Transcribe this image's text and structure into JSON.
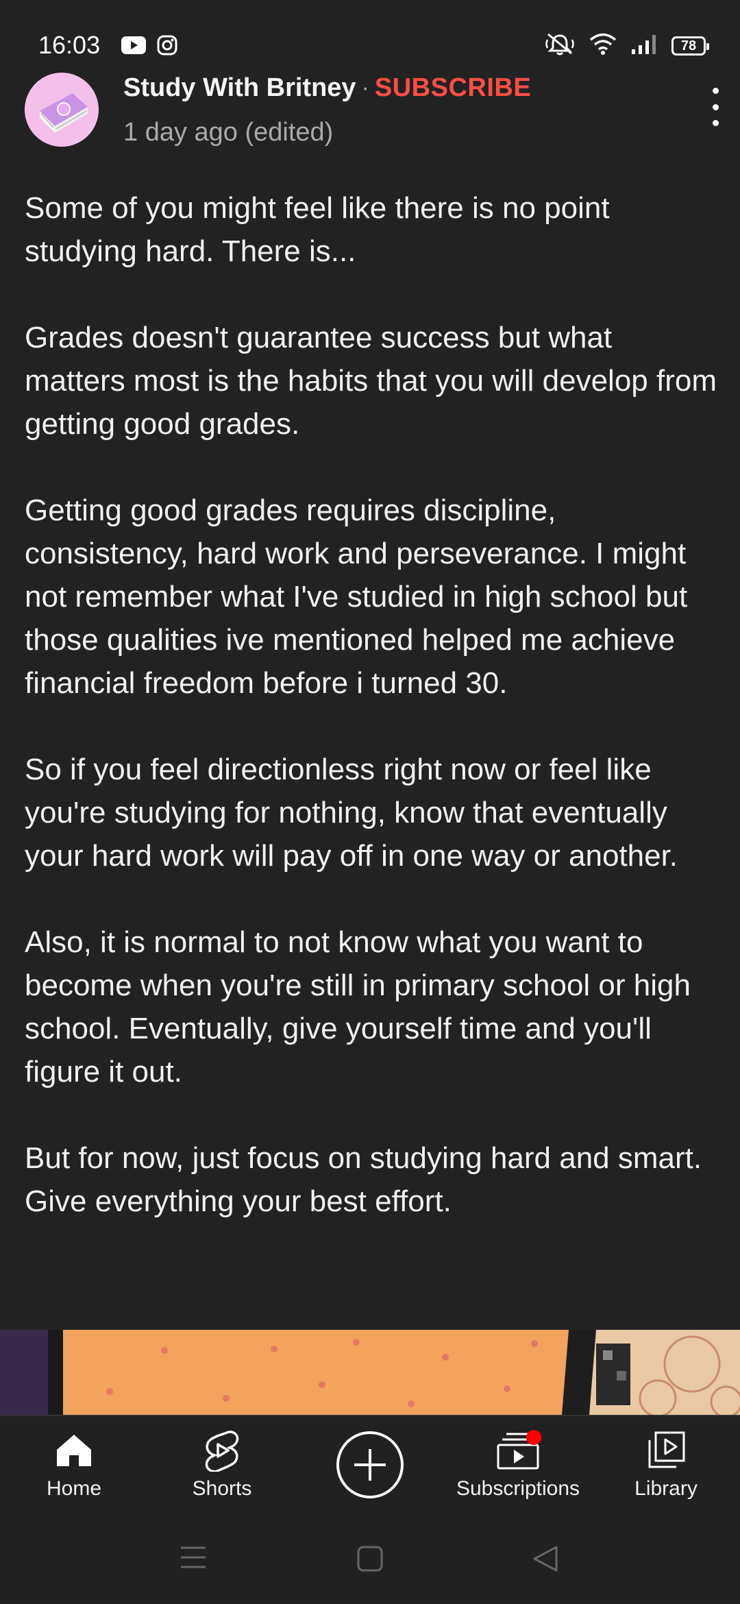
{
  "status_bar": {
    "time": "16:03",
    "battery": "78",
    "left_icons": [
      "youtube-icon",
      "instagram-icon"
    ],
    "right_icons": [
      "mute-icon",
      "wifi-icon",
      "signal-icon",
      "battery-icon"
    ]
  },
  "post": {
    "channel_name": "Study With Britney",
    "separator": "·",
    "subscribe_label": "SUBSCRIBE",
    "timestamp": "1 day ago (edited)",
    "paragraphs": [
      "Some of you might feel like there is no point studying hard. There is...",
      "Grades doesn't guarantee success but what matters most is the habits that you will develop from getting good grades.",
      "Getting good grades requires discipline, consistency, hard work and perseverance. I might not remember what I've studied in high school but those qualities ive mentioned helped me achieve financial freedom before i turned 30.",
      "So if you feel directionless right now or feel like you're studying for nothing, know that eventually your hard work will pay off in one way or another.",
      "Also, it is normal to not know what you want to become when you're still in primary school or high school. Eventually, give yourself time and you'll figure it out.",
      "But for now, just focus on studying hard and smart. Give everything your best effort."
    ]
  },
  "bottom_nav": {
    "items": [
      {
        "label": "Home",
        "icon": "home-icon"
      },
      {
        "label": "Shorts",
        "icon": "shorts-icon"
      },
      {
        "label": "",
        "icon": "create-icon"
      },
      {
        "label": "Subscriptions",
        "icon": "subscriptions-icon"
      },
      {
        "label": "Library",
        "icon": "library-icon"
      }
    ]
  },
  "colors": {
    "background": "#222222",
    "subscribe": "#ff4e45",
    "notification_dot": "#ff0000"
  }
}
